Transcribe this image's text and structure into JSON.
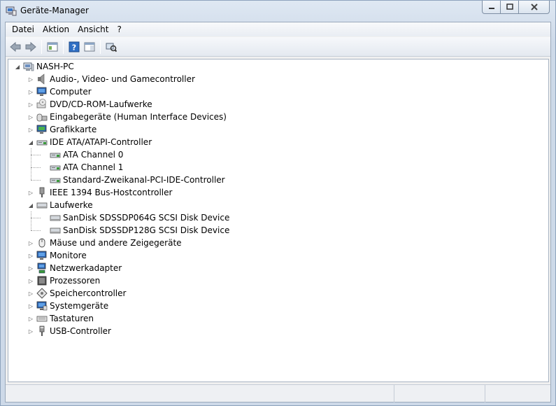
{
  "window": {
    "title": "Geräte-Manager"
  },
  "caption": {
    "minimize": "—",
    "maximize": "▢",
    "close": "✕"
  },
  "menu": [
    "Datei",
    "Aktion",
    "Ansicht",
    "?"
  ],
  "toolbar": [
    "back-arrow-icon",
    "forward-arrow-icon",
    "properties-pane-icon",
    "help-icon",
    "show-hide-console-icon",
    "scan-hardware-icon"
  ],
  "tree": {
    "root": {
      "label": "NASH-PC",
      "icon": "computer-icon",
      "expanded": true
    },
    "items": [
      {
        "label": "Audio-, Video- und Gamecontroller",
        "icon": "speaker-icon",
        "level": 1,
        "expanded": false
      },
      {
        "label": "Computer",
        "icon": "monitor-icon",
        "level": 1,
        "expanded": false
      },
      {
        "label": "DVD/CD-ROM-Laufwerke",
        "icon": "optical-drive-icon",
        "level": 1,
        "expanded": false
      },
      {
        "label": "Eingabegeräte (Human Interface Devices)",
        "icon": "hid-icon",
        "level": 1,
        "expanded": false
      },
      {
        "label": "Grafikkarte",
        "icon": "display-adapter-icon",
        "level": 1,
        "expanded": false
      },
      {
        "label": "IDE ATA/ATAPI-Controller",
        "icon": "ide-controller-icon",
        "level": 1,
        "expanded": true
      },
      {
        "label": "ATA Channel 0",
        "icon": "ide-controller-icon",
        "level": 2
      },
      {
        "label": "ATA Channel 1",
        "icon": "ide-controller-icon",
        "level": 2
      },
      {
        "label": "Standard-Zweikanal-PCI-IDE-Controller",
        "icon": "ide-controller-icon",
        "level": 2
      },
      {
        "label": "IEEE 1394 Bus-Hostcontroller",
        "icon": "firewire-icon",
        "level": 1,
        "expanded": false
      },
      {
        "label": "Laufwerke",
        "icon": "disk-drive-icon",
        "level": 1,
        "expanded": true
      },
      {
        "label": "SanDisk SDSSDP064G SCSI Disk Device",
        "icon": "disk-drive-icon",
        "level": 2
      },
      {
        "label": "SanDisk SDSSDP128G SCSI Disk Device",
        "icon": "disk-drive-icon",
        "level": 2
      },
      {
        "label": "Mäuse und andere Zeigegeräte",
        "icon": "mouse-icon",
        "level": 1,
        "expanded": false
      },
      {
        "label": "Monitore",
        "icon": "monitor-icon",
        "level": 1,
        "expanded": false
      },
      {
        "label": "Netzwerkadapter",
        "icon": "network-adapter-icon",
        "level": 1,
        "expanded": false
      },
      {
        "label": "Prozessoren",
        "icon": "processor-icon",
        "level": 1,
        "expanded": false
      },
      {
        "label": "Speichercontroller",
        "icon": "storage-controller-icon",
        "level": 1,
        "expanded": false
      },
      {
        "label": "Systemgeräte",
        "icon": "system-device-icon",
        "level": 1,
        "expanded": false
      },
      {
        "label": "Tastaturen",
        "icon": "keyboard-icon",
        "level": 1,
        "expanded": false
      },
      {
        "label": "USB-Controller",
        "icon": "usb-icon",
        "level": 1,
        "expanded": false
      }
    ]
  }
}
